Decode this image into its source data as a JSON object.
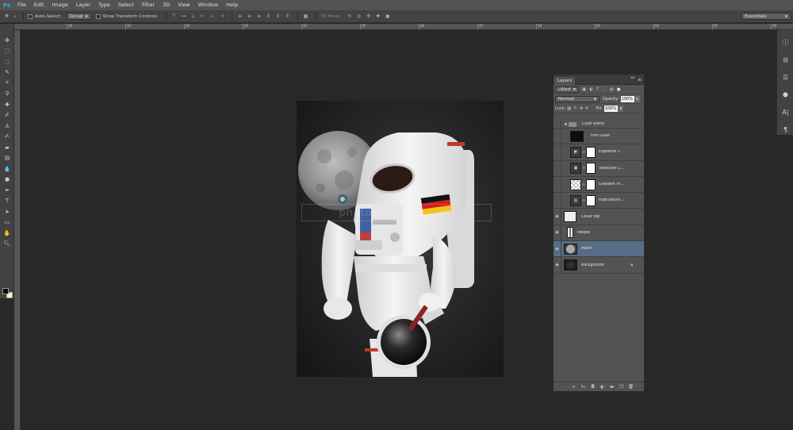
{
  "app": {
    "logo": "Ps"
  },
  "menu": [
    "File",
    "Edit",
    "Image",
    "Layer",
    "Type",
    "Select",
    "Filter",
    "3D",
    "View",
    "Window",
    "Help"
  ],
  "options_bar": {
    "tool_preset_icon": "move-tool-icon",
    "auto_select_label": "Auto-Select:",
    "auto_select_value": "Group",
    "show_transform_label": "Show Transform Controls",
    "mode_3d_label": "3D Mode:",
    "workspace": "Essentials"
  },
  "ruler": {
    "ticks": [
      "10",
      "15",
      "20",
      "25",
      "30",
      "35",
      "40",
      "45",
      "50",
      "55",
      "60",
      "65",
      "70"
    ]
  },
  "tools": [
    "move-tool",
    "marquee-tool",
    "lasso-tool",
    "quick-select-tool",
    "crop-tool",
    "eyedropper-tool",
    "spot-healing-tool",
    "brush-tool",
    "clone-stamp-tool",
    "history-brush-tool",
    "eraser-tool",
    "gradient-tool",
    "blur-tool",
    "dodge-tool",
    "pen-tool",
    "type-tool",
    "path-select-tool",
    "shape-tool",
    "hand-tool",
    "zoom-tool"
  ],
  "colors": {
    "foreground": "#0a0a0a",
    "background": "#fff5c8",
    "selected_layer": "#566d87"
  },
  "document": {
    "watermark": "photoshopcafe.com"
  },
  "layers_panel": {
    "tab": "Layers",
    "filter_kind": "Kind",
    "blend_mode": "Normal",
    "opacity_label": "Opacity:",
    "opacity_value": "100%",
    "lock_label": "Lock:",
    "fill_label": "Fill:",
    "fill_value": "100%",
    "layers": [
      {
        "name": "Color Blend",
        "type": "group",
        "visible": false
      },
      {
        "name": "Film Grain",
        "type": "pixel",
        "visible": false,
        "indent": true,
        "thumb": "#0e0e0e"
      },
      {
        "name": "Exposure 1",
        "type": "adjustment",
        "icon": "exposure-icon",
        "visible": false,
        "indent": true
      },
      {
        "name": "Selective C...",
        "type": "adjustment",
        "icon": "selective-color-icon",
        "visible": false,
        "indent": true
      },
      {
        "name": "Gradient Fil...",
        "type": "gradient",
        "visible": false,
        "indent": true
      },
      {
        "name": "Hue/Satura...",
        "type": "adjustment",
        "icon": "hue-saturation-icon",
        "visible": false,
        "indent": true
      },
      {
        "name": "Collar top",
        "type": "pixel",
        "visible": true,
        "thumb": "#d8d8d8"
      },
      {
        "name": "People",
        "type": "pixel",
        "visible": true,
        "thumb": "#cfcfcf"
      },
      {
        "name": "Moon",
        "type": "pixel",
        "visible": true,
        "selected": true,
        "thumb": "#9a9a9a"
      },
      {
        "name": "Background",
        "type": "background",
        "visible": true,
        "locked": true,
        "italic": true,
        "thumb": "#1c1c1c"
      }
    ]
  }
}
